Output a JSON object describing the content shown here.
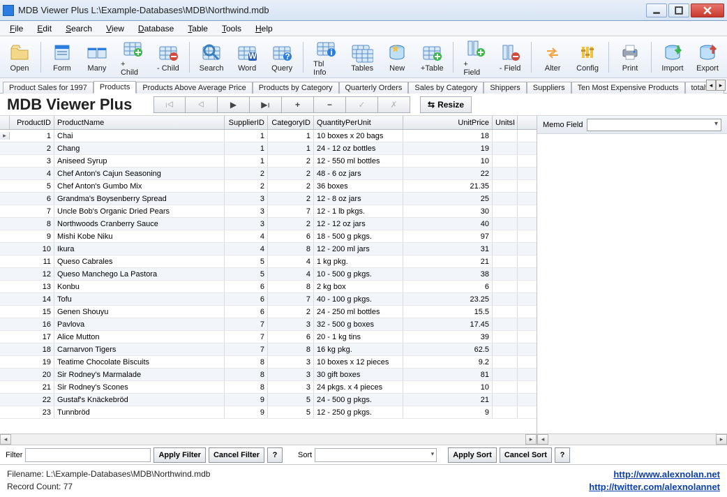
{
  "window": {
    "title": "MDB Viewer Plus L:\\Example-Databases\\MDB\\Northwind.mdb"
  },
  "menu": {
    "items": [
      "File",
      "Edit",
      "Search",
      "View",
      "Database",
      "Table",
      "Tools",
      "Help"
    ]
  },
  "toolbar": {
    "buttons": [
      {
        "label": "Open",
        "icon": "folder"
      },
      {
        "label": "Form",
        "icon": "form"
      },
      {
        "label": "Many",
        "icon": "many"
      },
      {
        "label": "+ Child",
        "icon": "plus-child"
      },
      {
        "label": "- Child",
        "icon": "minus-child"
      },
      {
        "label": "Search",
        "icon": "search"
      },
      {
        "label": "Word",
        "icon": "word"
      },
      {
        "label": "Query",
        "icon": "query"
      },
      {
        "label": "Tbl Info",
        "icon": "tblinfo"
      },
      {
        "label": "Tables",
        "icon": "tables"
      },
      {
        "label": "New",
        "icon": "new"
      },
      {
        "label": "+Table",
        "icon": "plus-table"
      },
      {
        "label": "+ Field",
        "icon": "plus-field"
      },
      {
        "label": "- Field",
        "icon": "minus-field"
      },
      {
        "label": "Alter",
        "icon": "alter"
      },
      {
        "label": "Config",
        "icon": "config"
      },
      {
        "label": "Print",
        "icon": "print"
      },
      {
        "label": "Import",
        "icon": "import"
      },
      {
        "label": "Export",
        "icon": "export"
      }
    ]
  },
  "tabs": {
    "items": [
      "Product Sales for 1997",
      "Products",
      "Products Above Average Price",
      "Products by Category",
      "Quarterly Orders",
      "Sales by Category",
      "Shippers",
      "Suppliers",
      "Ten Most Expensive Products",
      "totaltest"
    ],
    "active": 1
  },
  "big_title": "MDB Viewer Plus",
  "nav": {
    "resize_label": "Resize"
  },
  "grid": {
    "columns": [
      "ProductID",
      "ProductName",
      "SupplierID",
      "CategoryID",
      "QuantityPerUnit",
      "UnitPrice",
      "UnitsI"
    ],
    "rows": [
      {
        "pid": 1,
        "pname": "Chai",
        "sid": 1,
        "cid": 1,
        "qpu": "10 boxes x 20 bags",
        "price": "18"
      },
      {
        "pid": 2,
        "pname": "Chang",
        "sid": 1,
        "cid": 1,
        "qpu": "24 - 12 oz bottles",
        "price": "19"
      },
      {
        "pid": 3,
        "pname": "Aniseed Syrup",
        "sid": 1,
        "cid": 2,
        "qpu": "12 - 550 ml bottles",
        "price": "10"
      },
      {
        "pid": 4,
        "pname": "Chef Anton's Cajun Seasoning",
        "sid": 2,
        "cid": 2,
        "qpu": "48 - 6 oz jars",
        "price": "22"
      },
      {
        "pid": 5,
        "pname": "Chef Anton's Gumbo Mix",
        "sid": 2,
        "cid": 2,
        "qpu": "36 boxes",
        "price": "21.35"
      },
      {
        "pid": 6,
        "pname": "Grandma's Boysenberry Spread",
        "sid": 3,
        "cid": 2,
        "qpu": "12 - 8 oz jars",
        "price": "25"
      },
      {
        "pid": 7,
        "pname": "Uncle Bob's Organic Dried Pears",
        "sid": 3,
        "cid": 7,
        "qpu": "12 - 1 lb pkgs.",
        "price": "30"
      },
      {
        "pid": 8,
        "pname": "Northwoods Cranberry Sauce",
        "sid": 3,
        "cid": 2,
        "qpu": "12 - 12 oz jars",
        "price": "40"
      },
      {
        "pid": 9,
        "pname": "Mishi Kobe Niku",
        "sid": 4,
        "cid": 6,
        "qpu": "18 - 500 g pkgs.",
        "price": "97"
      },
      {
        "pid": 10,
        "pname": "Ikura",
        "sid": 4,
        "cid": 8,
        "qpu": "12 - 200 ml jars",
        "price": "31"
      },
      {
        "pid": 11,
        "pname": "Queso Cabrales",
        "sid": 5,
        "cid": 4,
        "qpu": "1 kg pkg.",
        "price": "21"
      },
      {
        "pid": 12,
        "pname": "Queso Manchego La Pastora",
        "sid": 5,
        "cid": 4,
        "qpu": "10 - 500 g pkgs.",
        "price": "38"
      },
      {
        "pid": 13,
        "pname": "Konbu",
        "sid": 6,
        "cid": 8,
        "qpu": "2 kg box",
        "price": "6"
      },
      {
        "pid": 14,
        "pname": "Tofu",
        "sid": 6,
        "cid": 7,
        "qpu": "40 - 100 g pkgs.",
        "price": "23.25"
      },
      {
        "pid": 15,
        "pname": "Genen Shouyu",
        "sid": 6,
        "cid": 2,
        "qpu": "24 - 250 ml bottles",
        "price": "15.5"
      },
      {
        "pid": 16,
        "pname": "Pavlova",
        "sid": 7,
        "cid": 3,
        "qpu": "32 - 500 g boxes",
        "price": "17.45"
      },
      {
        "pid": 17,
        "pname": "Alice Mutton",
        "sid": 7,
        "cid": 6,
        "qpu": "20 - 1 kg tins",
        "price": "39"
      },
      {
        "pid": 18,
        "pname": "Carnarvon Tigers",
        "sid": 7,
        "cid": 8,
        "qpu": "16 kg pkg.",
        "price": "62.5"
      },
      {
        "pid": 19,
        "pname": "Teatime Chocolate Biscuits",
        "sid": 8,
        "cid": 3,
        "qpu": "10 boxes x 12 pieces",
        "price": "9.2"
      },
      {
        "pid": 20,
        "pname": "Sir Rodney's Marmalade",
        "sid": 8,
        "cid": 3,
        "qpu": "30 gift boxes",
        "price": "81"
      },
      {
        "pid": 21,
        "pname": "Sir Rodney's Scones",
        "sid": 8,
        "cid": 3,
        "qpu": "24 pkgs. x 4 pieces",
        "price": "10"
      },
      {
        "pid": 22,
        "pname": "Gustaf's Knäckebröd",
        "sid": 9,
        "cid": 5,
        "qpu": "24 - 500 g pkgs.",
        "price": "21"
      },
      {
        "pid": 23,
        "pname": "Tunnbröd",
        "sid": 9,
        "cid": 5,
        "qpu": "12 - 250 g pkgs.",
        "price": "9"
      }
    ]
  },
  "memo": {
    "label": "Memo Field"
  },
  "filterbar": {
    "filter_label": "Filter",
    "apply_filter": "Apply Filter",
    "cancel_filter": "Cancel Filter",
    "sort_label": "Sort",
    "apply_sort": "Apply Sort",
    "cancel_sort": "Cancel Sort",
    "q": "?"
  },
  "status": {
    "filename_label": "Filename: L:\\Example-Databases\\MDB\\Northwind.mdb",
    "record_label": "Record Count: 77",
    "link1": "http://www.alexnolan.net",
    "link2": "http://twitter.com/alexnolannet"
  },
  "icons": {
    "base_table": "#bcd6ef",
    "accent_blue": "#2b7de0",
    "accent_green": "#3cb54a",
    "accent_red": "#d04a3e",
    "accent_yellow": "#f4c23e"
  }
}
